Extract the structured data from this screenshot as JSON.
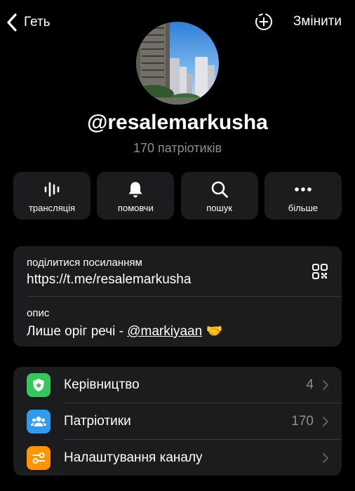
{
  "header": {
    "back_label": "Геть",
    "edit_label": "Змінити"
  },
  "profile": {
    "username": "@resalemarkusha",
    "subscribers": "170 патріотиків"
  },
  "actions": [
    {
      "label": "трансляція",
      "icon": "broadcast-waveform-icon"
    },
    {
      "label": "помовчи",
      "icon": "bell-icon"
    },
    {
      "label": "пошук",
      "icon": "search-icon"
    },
    {
      "label": "більше",
      "icon": "more-dots-icon"
    }
  ],
  "info": {
    "link_label": "поділитися посиланням",
    "link_value": "https://t.me/resalemarkusha",
    "description_label": "опис",
    "description_text": "Лише оріг речі - ",
    "description_mention": "@markiyaan",
    "description_emoji": "🤝"
  },
  "settings": [
    {
      "label": "Керівництво",
      "value": "4",
      "icon": "admin-badge-icon",
      "color": "#34c759"
    },
    {
      "label": "Патріотики",
      "value": "170",
      "icon": "people-icon",
      "color": "#2f9bed"
    },
    {
      "label": "Налаштування каналу",
      "value": "",
      "icon": "channel-settings-icon",
      "color": "#ff9500"
    }
  ],
  "colors": {
    "background": "#000000",
    "card": "#1c1c1e",
    "secondary_text": "#8e8e93",
    "separator": "#38383a"
  }
}
